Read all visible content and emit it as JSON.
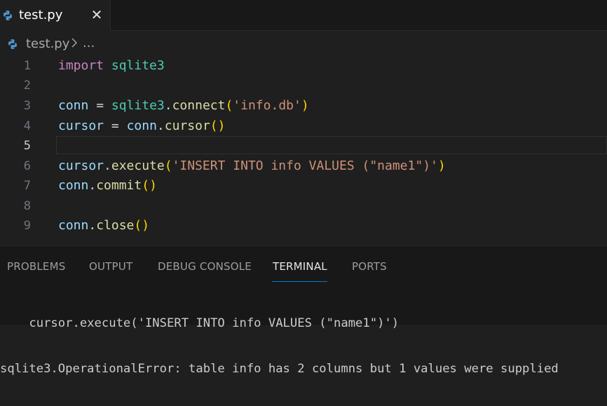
{
  "tab": {
    "label": "test.py",
    "close_glyph": "✕",
    "icon": "python-icon"
  },
  "breadcrumb": {
    "file": "test.py",
    "separator_icon": "chevron-right-icon",
    "ellipsis": "..."
  },
  "editor": {
    "current_line": 5,
    "lines": [
      {
        "number": "1",
        "text": "import sqlite3"
      },
      {
        "number": "2",
        "text": ""
      },
      {
        "number": "3",
        "text": "conn = sqlite3.connect('info.db')"
      },
      {
        "number": "4",
        "text": "cursor = conn.cursor()"
      },
      {
        "number": "5",
        "text": ""
      },
      {
        "number": "6",
        "text": "cursor.execute('INSERT INTO info VALUES (\"name1\")')"
      },
      {
        "number": "7",
        "text": "conn.commit()"
      },
      {
        "number": "8",
        "text": ""
      },
      {
        "number": "9",
        "text": "conn.close()"
      }
    ]
  },
  "panel": {
    "tabs": [
      "PROBLEMS",
      "OUTPUT",
      "DEBUG CONSOLE",
      "TERMINAL",
      "PORTS"
    ],
    "active_tab": "TERMINAL",
    "terminal_lines": [
      "    cursor.execute('INSERT INTO info VALUES (\"name1\")')",
      "sqlite3.OperationalError: table info has 2 columns but 1 values were supplied"
    ]
  },
  "colors": {
    "accent": "#0078d4",
    "background": "#1f1f1f",
    "keyword": "#c586c0",
    "module": "#4ec9b0",
    "string": "#ce9178",
    "function": "#dcdcaa",
    "bracket": "#ffd700",
    "variable": "#9cdcfe"
  }
}
